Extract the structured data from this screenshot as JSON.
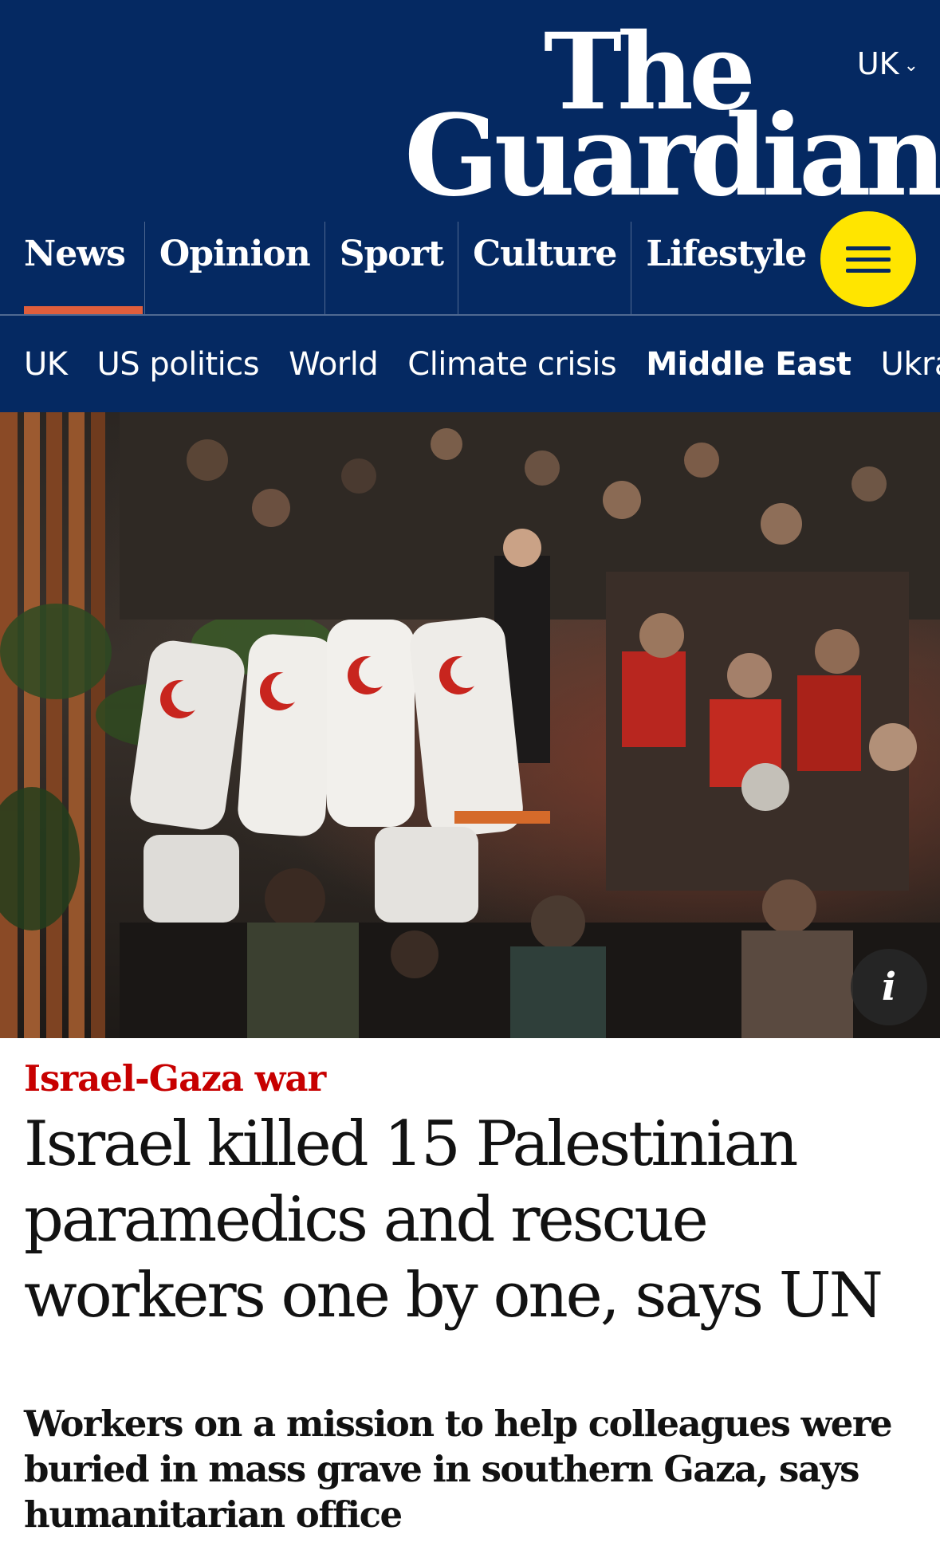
{
  "header": {
    "edition_label": "UK",
    "logo_line1": "The",
    "logo_line2": "Guardian",
    "brand_color": "#052962",
    "accent_color": "#ffe500",
    "pillars": [
      {
        "label": "News",
        "active": true
      },
      {
        "label": "Opinion",
        "active": false
      },
      {
        "label": "Sport",
        "active": false
      },
      {
        "label": "Culture",
        "active": false
      },
      {
        "label": "Lifestyle",
        "active": false
      }
    ],
    "menu_icon": "hamburger-menu-icon"
  },
  "subnav": {
    "items": [
      "UK",
      "US politics",
      "World",
      "Climate crisis",
      "Middle East",
      "Ukraine"
    ],
    "current": "Middle East"
  },
  "hero": {
    "info_label": "i"
  },
  "article": {
    "kicker": "Israel-Gaza war",
    "kicker_color": "#c70000",
    "headline_line1": "Israel killed 15 Palestinian",
    "headline_line2": "paramedics and rescue",
    "headline_line3": "workers one by one, says UN",
    "standfirst_line1": "Workers on a mission to help colleagues were",
    "standfirst_line2": "buried in mass grave in southern Gaza, says",
    "standfirst_line3": "humanitarian office"
  }
}
